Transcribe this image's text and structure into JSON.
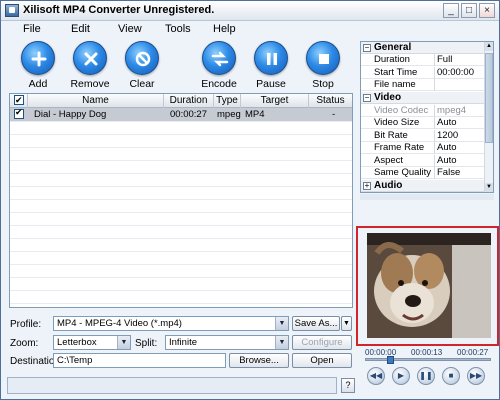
{
  "window": {
    "title": "Xilisoft MP4 Converter Unregistered.",
    "minimize": "_",
    "maximize": "□",
    "close": "×"
  },
  "menu": [
    "File",
    "Edit",
    "View",
    "Tools",
    "Help"
  ],
  "toolbar": {
    "add": "Add",
    "remove": "Remove",
    "clear": "Clear",
    "encode": "Encode",
    "pause": "Pause",
    "stop": "Stop"
  },
  "file_list": {
    "columns": [
      "Name",
      "Duration",
      "Type",
      "Target",
      "Status"
    ],
    "rows": [
      {
        "checked": true,
        "name": "Dial - Happy Dog",
        "duration": "00:00:27",
        "type": "mpeg",
        "target": "MP4",
        "status": "-"
      }
    ]
  },
  "controls": {
    "profile_label": "Profile:",
    "profile_value": "MP4 - MPEG-4 Video  (*.mp4)",
    "save_as": "Save As...",
    "zoom_label": "Zoom:",
    "zoom_value": "Letterbox",
    "split_label": "Split:",
    "split_value": "Infinite",
    "configure": "Configure",
    "destination_label": "Destination:",
    "destination_value": "C:\\Temp",
    "browse": "Browse...",
    "open": "Open"
  },
  "properties": {
    "sections": [
      {
        "name": "General",
        "rows": [
          {
            "k": "Duration",
            "v": "Full"
          },
          {
            "k": "Start Time",
            "v": "00:00:00"
          },
          {
            "k": "File name",
            "v": ""
          }
        ]
      },
      {
        "name": "Video",
        "rows": [
          {
            "k": "Video Codec",
            "v": "mpeg4",
            "grey": true
          },
          {
            "k": "Video Size",
            "v": "Auto"
          },
          {
            "k": "Bit Rate",
            "v": "1200"
          },
          {
            "k": "Frame Rate",
            "v": "Auto"
          },
          {
            "k": "Aspect",
            "v": "Auto"
          },
          {
            "k": "Same Quality",
            "v": "False"
          }
        ]
      },
      {
        "name": "Audio",
        "rows": []
      }
    ]
  },
  "player": {
    "time_current": "00:00:00",
    "time_mid": "00:00:13",
    "time_end": "00:00:27",
    "seek_progress": 0.18
  },
  "status_bar": {
    "text": "",
    "help": "?"
  }
}
